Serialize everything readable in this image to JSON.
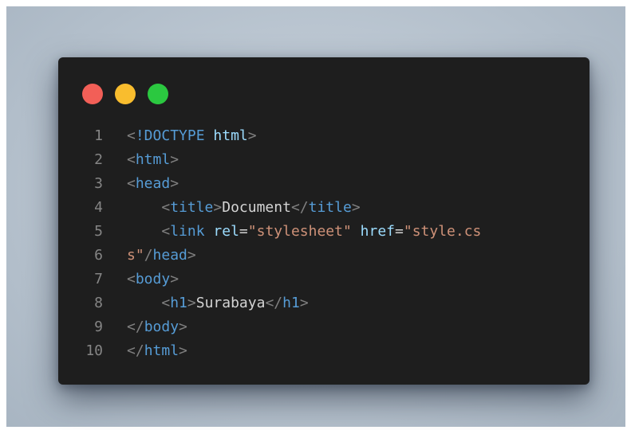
{
  "window": {
    "controls": [
      {
        "name": "close",
        "color": "#f25f57"
      },
      {
        "name": "minimize",
        "color": "#f9bd2e"
      },
      {
        "name": "maximize",
        "color": "#2bc840"
      }
    ]
  },
  "colors": {
    "editor_bg": "#1e1e1e",
    "backdrop": "#bcc7d2",
    "tag": "#569cd6",
    "attribute": "#9cdcfe",
    "string": "#ce9178",
    "punctuation": "#808080",
    "line_number": "#858585"
  },
  "code": {
    "lines": [
      {
        "n": "1",
        "tokens": [
          {
            "t": "<",
            "c": "punct"
          },
          {
            "t": "!DOCTYPE",
            "c": "tag"
          },
          {
            "t": " ",
            "c": "text"
          },
          {
            "t": "html",
            "c": "attr"
          },
          {
            "t": ">",
            "c": "punct"
          }
        ]
      },
      {
        "n": "2",
        "tokens": [
          {
            "t": "<",
            "c": "punct"
          },
          {
            "t": "html",
            "c": "tag"
          },
          {
            "t": ">",
            "c": "punct"
          }
        ]
      },
      {
        "n": "3",
        "tokens": [
          {
            "t": "<",
            "c": "punct"
          },
          {
            "t": "head",
            "c": "tag"
          },
          {
            "t": ">",
            "c": "punct"
          }
        ]
      },
      {
        "n": "4",
        "tokens": [
          {
            "t": "    ",
            "c": "text"
          },
          {
            "t": "<",
            "c": "punct"
          },
          {
            "t": "title",
            "c": "tag"
          },
          {
            "t": ">",
            "c": "punct"
          },
          {
            "t": "Document",
            "c": "text"
          },
          {
            "t": "</",
            "c": "punct"
          },
          {
            "t": "title",
            "c": "tag"
          },
          {
            "t": ">",
            "c": "punct"
          }
        ]
      },
      {
        "n": "5",
        "tokens": [
          {
            "t": "    ",
            "c": "text"
          },
          {
            "t": "<",
            "c": "punct"
          },
          {
            "t": "link",
            "c": "tag"
          },
          {
            "t": " ",
            "c": "text"
          },
          {
            "t": "rel",
            "c": "attr"
          },
          {
            "t": "=",
            "c": "text"
          },
          {
            "t": "\"stylesheet\"",
            "c": "str"
          },
          {
            "t": " ",
            "c": "text"
          },
          {
            "t": "href",
            "c": "attr"
          },
          {
            "t": "=",
            "c": "text"
          },
          {
            "t": "\"style.cs",
            "c": "str"
          }
        ]
      },
      {
        "n": "6",
        "tokens": [
          {
            "t": "s\"",
            "c": "str"
          },
          {
            "t": "/",
            "c": "punct"
          },
          {
            "t": "head",
            "c": "tag"
          },
          {
            "t": ">",
            "c": "punct"
          }
        ]
      },
      {
        "n": "7",
        "tokens": [
          {
            "t": "<",
            "c": "punct"
          },
          {
            "t": "body",
            "c": "tag"
          },
          {
            "t": ">",
            "c": "punct"
          }
        ]
      },
      {
        "n": "8",
        "tokens": [
          {
            "t": "    ",
            "c": "text"
          },
          {
            "t": "<",
            "c": "punct"
          },
          {
            "t": "h1",
            "c": "tag"
          },
          {
            "t": ">",
            "c": "punct"
          },
          {
            "t": "Surabaya",
            "c": "text"
          },
          {
            "t": "</",
            "c": "punct"
          },
          {
            "t": "h1",
            "c": "tag"
          },
          {
            "t": ">",
            "c": "punct"
          }
        ]
      },
      {
        "n": "9",
        "tokens": [
          {
            "t": "</",
            "c": "punct"
          },
          {
            "t": "body",
            "c": "tag"
          },
          {
            "t": ">",
            "c": "punct"
          }
        ]
      },
      {
        "n": "10",
        "tokens": [
          {
            "t": "</",
            "c": "punct"
          },
          {
            "t": "html",
            "c": "tag"
          },
          {
            "t": ">",
            "c": "punct"
          }
        ]
      }
    ]
  }
}
